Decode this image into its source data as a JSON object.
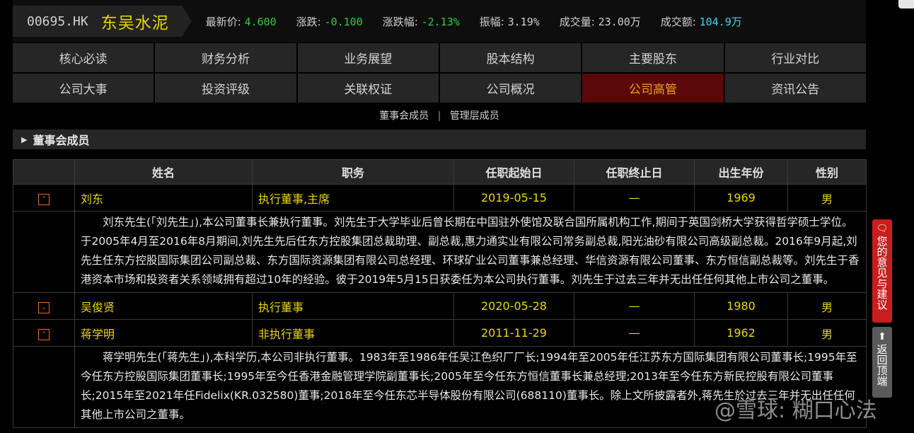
{
  "header": {
    "code": "00695.HK",
    "name": "东吴水泥",
    "quotes": [
      {
        "label": "最新价:",
        "value": "4.600",
        "color": "#2ecc40"
      },
      {
        "label": "涨跌:",
        "value": "-0.100",
        "color": "#2ecc40"
      },
      {
        "label": "涨跌幅:",
        "value": "-2.13%",
        "color": "#2ecc40"
      },
      {
        "label": "振幅:",
        "value": "3.19%",
        "color": "#cfcfcf"
      },
      {
        "label": "成交量:",
        "value": "23.00万",
        "color": "#cfcfcf"
      },
      {
        "label": "成交额:",
        "value": "104.9万",
        "color": "#3fd6f0"
      }
    ]
  },
  "tabs_row1": [
    "核心必读",
    "财务分析",
    "业务展望",
    "股本结构",
    "主要股东",
    "行业对比"
  ],
  "tabs_row2": [
    "公司大事",
    "投资评级",
    "关联权证",
    "公司概况",
    "公司高管",
    "资讯公告"
  ],
  "active_tab": "公司高管",
  "subnav": {
    "active": "董事会成员",
    "sep": "|",
    "other": "管理层成员"
  },
  "section_title": "董事会成员",
  "table": {
    "headers": [
      "姓名",
      "职务",
      "任职起始日",
      "任职终止日",
      "出生年份",
      "性别"
    ],
    "rows": [
      {
        "expanded": true,
        "name": "刘东",
        "role": "执行董事,主席",
        "start": "2019-05-15",
        "end": "—",
        "born": "1969",
        "gender": "男",
        "bio": "刘东先生(「刘先生」),本公司董事长兼执行董事。刘先生于大学毕业后曾长期在中国驻外使馆及联合国所属机构工作,期间于英国剑桥大学获得哲学硕士学位。于2005年4月至2016年8月期间,刘先生先后任东方控股集团总裁助理、副总裁,惠力通实业有限公司常务副总裁,阳光油砂有限公司高级副总裁。2016年9月起,刘先生任东方控股国际集团公司副总裁、东方国际资源集团有限公司总经理、环球矿业公司董事兼总经理、华信资源有限公司董事、东方恒信副总裁等。刘先生于香港资本市场和投资者关系领域拥有超过10年的经验。彼于2019年5月15日获委任为本公司执行董事。刘先生于过去三年并无出任任何其他上市公司之董事。"
      },
      {
        "expanded": false,
        "name": "吴俊贤",
        "role": "执行董事",
        "start": "2020-05-28",
        "end": "—",
        "born": "1980",
        "gender": "男",
        "bio": ""
      },
      {
        "expanded": true,
        "name": "蒋学明",
        "role": "非执行董事",
        "start": "2011-11-29",
        "end": "—",
        "born": "1962",
        "gender": "男",
        "bio": "蒋学明先生(「蒋先生」),本科学历,本公司非执行董事。1983年至1986年任吴江色织厂厂长;1994年至2005年任江苏东方国际集团有限公司董事长;1995年至今任东方控股国际集团董事长;1995年至今任香港金融管理学院副董事长;2005年至今任东方恒信董事长兼总经理;2013年至今任东方新民控股有限公司董事长;2015年至2021年任Fidelix(KR.032580)董事;2018年至今任东芯半导体股份有限公司(688110)董事长。除上文所披露者外,蒋先生於过去三年并无出任任何其他上市公司之董事。"
      }
    ]
  },
  "side": {
    "feedback_icon": "speech-bubble-icon",
    "feedback_text": "您的意见与建议",
    "backtop_icon": "arrow-up-icon",
    "backtop_text": "返回顶端"
  },
  "watermark": "@雪球: 糊口心法"
}
